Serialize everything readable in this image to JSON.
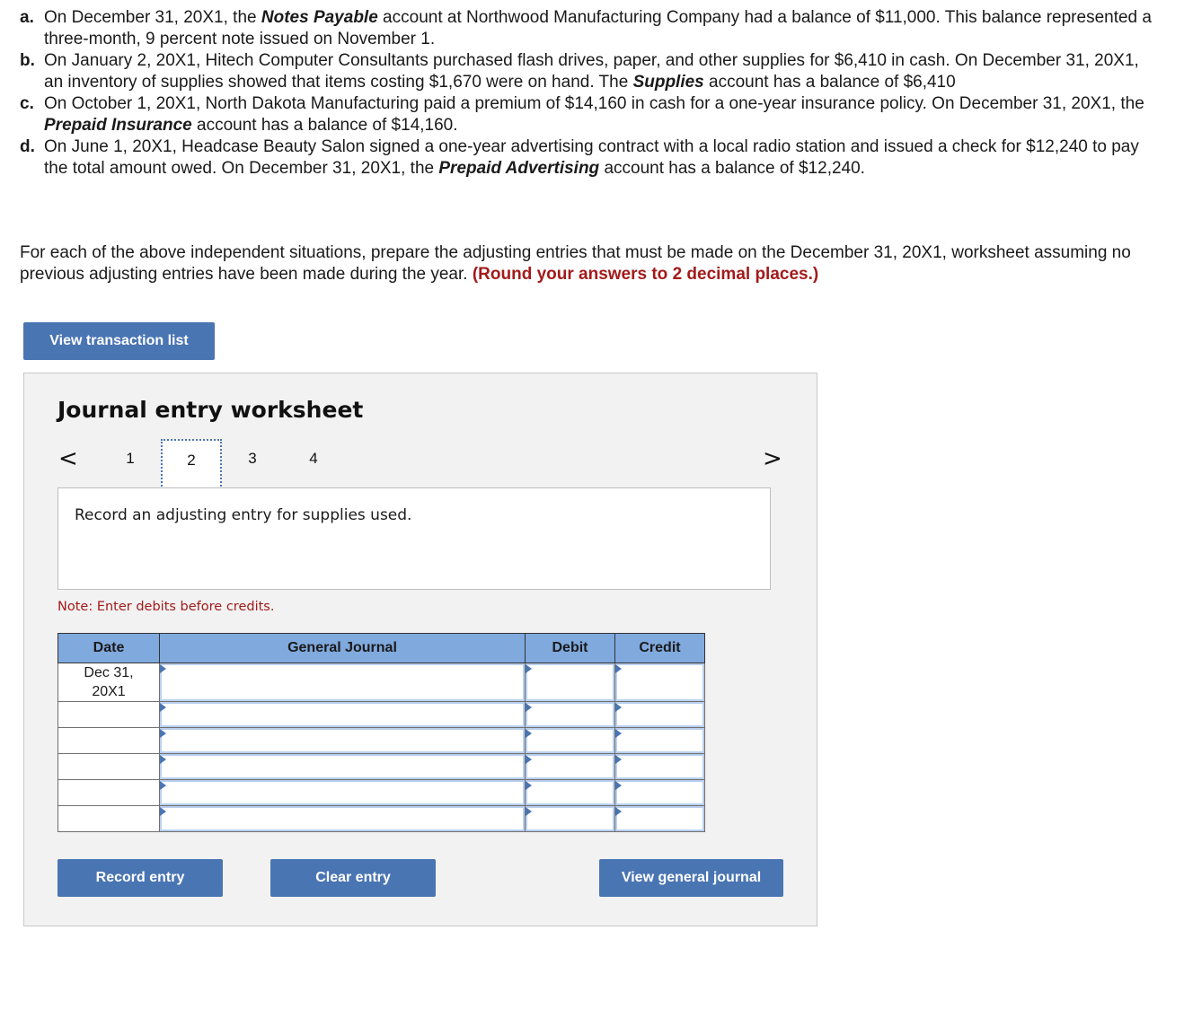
{
  "problems": [
    {
      "label": "a.",
      "parts": [
        {
          "t": "On December 31, 20X1, the "
        },
        {
          "t": "Notes Payable",
          "acct": true
        },
        {
          "t": " account at Northwood Manufacturing Company had a balance of $11,000. This balance represented a three-month, 9 percent note issued on November 1."
        }
      ]
    },
    {
      "label": "b.",
      "parts": [
        {
          "t": "On January 2, 20X1, Hitech Computer Consultants purchased flash drives, paper, and other supplies for $6,410 in cash. On December 31, 20X1, an inventory of supplies showed that items costing $1,670 were on hand. The "
        },
        {
          "t": "Supplies",
          "acct": true
        },
        {
          "t": " account has a balance of $6,410"
        }
      ]
    },
    {
      "label": "c.",
      "parts": [
        {
          "t": "On October 1, 20X1, North Dakota Manufacturing paid a premium of $14,160 in cash for a one-year insurance policy. On December 31, 20X1, the "
        },
        {
          "t": "Prepaid Insurance",
          "acct": true
        },
        {
          "t": " account has a balance of $14,160."
        }
      ]
    },
    {
      "label": "d.",
      "parts": [
        {
          "t": "On June 1, 20X1, Headcase Beauty Salon signed a one-year advertising contract with a local radio station and issued a check for $12,240 to pay the total amount owed. On December 31, 20X1, the "
        },
        {
          "t": "Prepaid Advertising",
          "acct": true
        },
        {
          "t": " account has a balance of $12,240."
        }
      ]
    }
  ],
  "instructions": {
    "text": "For each of the above independent situations, prepare the adjusting entries that must be made on the December 31, 20X1, worksheet assuming no previous adjusting entries have been made during the year. ",
    "emphasis": "(Round your answers to 2 decimal places.)"
  },
  "buttons": {
    "view_transaction_list": "View transaction list",
    "record_entry": "Record entry",
    "clear_entry": "Clear entry",
    "view_general_journal": "View general journal"
  },
  "worksheet": {
    "title": "Journal entry worksheet",
    "prev_icon": "chevron-left-icon",
    "next_icon": "chevron-right-icon",
    "prev_glyph": "<",
    "next_glyph": ">",
    "steps": [
      "1",
      "2",
      "3",
      "4"
    ],
    "active_step": "2",
    "prompt": "Record an adjusting entry for supplies used.",
    "note": "Note: Enter debits before credits."
  },
  "journal": {
    "headers": {
      "date": "Date",
      "general_journal": "General Journal",
      "debit": "Debit",
      "credit": "Credit"
    },
    "rows": [
      {
        "date_line1": "Dec 31,",
        "date_line2": "20X1",
        "account": "",
        "debit": "",
        "credit": ""
      },
      {
        "date_line1": "",
        "date_line2": "",
        "account": "",
        "debit": "",
        "credit": ""
      },
      {
        "date_line1": "",
        "date_line2": "",
        "account": "",
        "debit": "",
        "credit": ""
      },
      {
        "date_line1": "",
        "date_line2": "",
        "account": "",
        "debit": "",
        "credit": ""
      },
      {
        "date_line1": "",
        "date_line2": "",
        "account": "",
        "debit": "",
        "credit": ""
      },
      {
        "date_line1": "",
        "date_line2": "",
        "account": "",
        "debit": "",
        "credit": ""
      }
    ]
  },
  "colors": {
    "button_bg": "#4a75b3",
    "header_bg": "#80a9dd",
    "emphasis_red": "#a31a1a",
    "panel_bg": "#f2f2f2"
  }
}
